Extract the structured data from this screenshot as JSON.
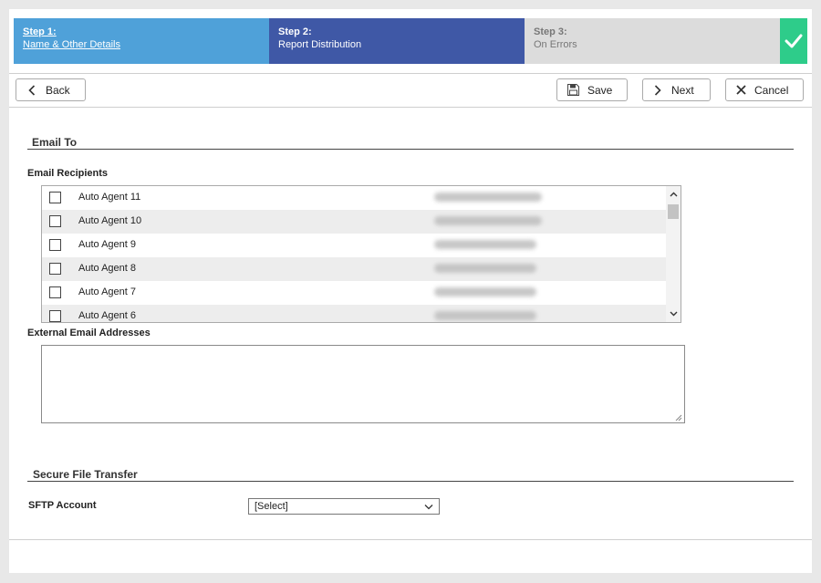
{
  "stepper": {
    "steps": [
      {
        "title": "Step 1:",
        "label": "Name & Other Details"
      },
      {
        "title": "Step 2:",
        "label": "Report Distribution"
      },
      {
        "title": "Step 3:",
        "label": "On Errors"
      }
    ],
    "colors": {
      "step1": "#4fa1d9",
      "step2": "#3f58a6",
      "step3": "#dcdcdc",
      "complete": "#2ecc8a"
    }
  },
  "toolbar": {
    "back_label": "Back",
    "save_label": "Save",
    "next_label": "Next",
    "cancel_label": "Cancel"
  },
  "email_to": {
    "section_title": "Email To",
    "recipients_label": "Email Recipients",
    "recipients": [
      {
        "name": "Auto Agent 11",
        "checked": false
      },
      {
        "name": "Auto Agent 10",
        "checked": false
      },
      {
        "name": "Auto Agent 9",
        "checked": false
      },
      {
        "name": "Auto Agent 8",
        "checked": false
      },
      {
        "name": "Auto Agent 7",
        "checked": false
      },
      {
        "name": "Auto Agent 6",
        "checked": false
      }
    ],
    "external_label": "External Email Addresses",
    "external_value": ""
  },
  "secure_file_transfer": {
    "section_title": "Secure File Transfer",
    "sftp_label": "SFTP Account",
    "sftp_selected": "[Select]"
  }
}
